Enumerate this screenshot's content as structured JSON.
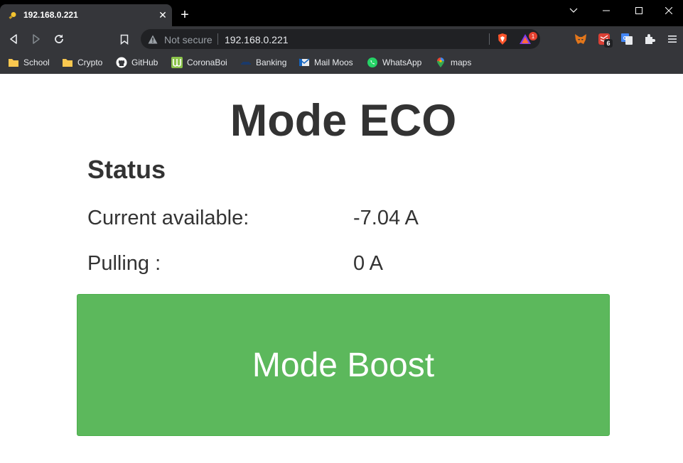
{
  "browser": {
    "tab": {
      "title": "192.168.0.221",
      "favicon": "lightbulb-icon"
    },
    "omnibox": {
      "security_label": "Not secure",
      "url": "192.168.0.221"
    },
    "rewards_badge": "1",
    "extensions": [
      {
        "name": "metamask-icon"
      },
      {
        "name": "todoist-icon",
        "badge": "6"
      },
      {
        "name": "google-translate-icon"
      },
      {
        "name": "extensions-puzzle-icon"
      }
    ],
    "bookmarks": [
      {
        "label": "School",
        "icon": "folder-icon"
      },
      {
        "label": "Crypto",
        "icon": "folder-icon"
      },
      {
        "label": "GitHub",
        "icon": "github-icon"
      },
      {
        "label": "CoronaBoi",
        "icon": "coronaboi-icon"
      },
      {
        "label": "Banking",
        "icon": "bank-icon"
      },
      {
        "label": "Mail Moos",
        "icon": "mail-icon"
      },
      {
        "label": "WhatsApp",
        "icon": "whatsapp-icon"
      },
      {
        "label": "maps",
        "icon": "maps-pin-icon"
      }
    ]
  },
  "page": {
    "title": "Mode ECO",
    "status_heading": "Status",
    "rows": [
      {
        "label": "Current available:",
        "value": "-7.04 A"
      },
      {
        "label": "Pulling :",
        "value": "0 A"
      }
    ],
    "button_label": "Mode Boost"
  },
  "colors": {
    "button_bg": "#5cb85c",
    "text": "#333333",
    "chrome_bg": "#35363a"
  }
}
